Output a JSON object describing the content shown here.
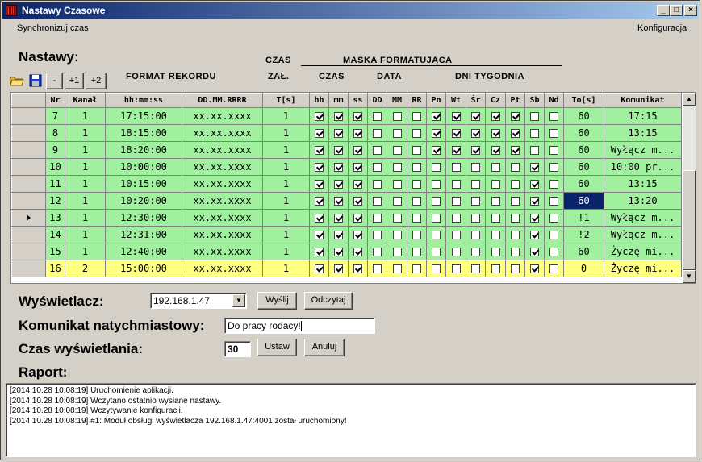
{
  "window": {
    "title": "Nastawy Czasowe"
  },
  "titlebar_buttons": {
    "minimize": "_",
    "maximize": "□",
    "close": "×"
  },
  "menu": {
    "left": "Synchronizuj czas",
    "right": "Konfiguracja"
  },
  "nastawy_label": "Nastawy:",
  "toolbar": {
    "minus": "-",
    "plus1": "+1",
    "plus2": "+2"
  },
  "headers": {
    "format_rekordu": "FORMAT REKORDU",
    "czas": "CZAS",
    "zal": "ZAŁ.",
    "maska": "MASKA FORMATUJĄCA",
    "czas2": "CZAS",
    "data": "DATA",
    "dni": "DNI TYGODNIA"
  },
  "columns": [
    "",
    "Nr",
    "Kanał",
    "hh:mm:ss",
    "DD.MM.RRRR",
    "T[s]",
    "hh",
    "mm",
    "ss",
    "DD",
    "MM",
    "RR",
    "Pn",
    "Wt",
    "Śr",
    "Cz",
    "Pt",
    "Sb",
    "Nd",
    "To[s]",
    "Komunikat"
  ],
  "rows": [
    {
      "nr": "7",
      "kanal": "1",
      "time": "17:15:00",
      "date": "xx.xx.xxxx",
      "t": "1",
      "checks": [
        1,
        1,
        1,
        0,
        0,
        0,
        1,
        1,
        1,
        1,
        1,
        0,
        0
      ],
      "to": "60",
      "msg": "17:15",
      "style": "green"
    },
    {
      "nr": "8",
      "kanal": "1",
      "time": "18:15:00",
      "date": "xx.xx.xxxx",
      "t": "1",
      "checks": [
        1,
        1,
        1,
        0,
        0,
        0,
        1,
        1,
        1,
        1,
        1,
        0,
        0
      ],
      "to": "60",
      "msg": "13:15",
      "style": "green"
    },
    {
      "nr": "9",
      "kanal": "1",
      "time": "18:20:00",
      "date": "xx.xx.xxxx",
      "t": "1",
      "checks": [
        1,
        1,
        1,
        0,
        0,
        0,
        1,
        1,
        1,
        1,
        1,
        0,
        0
      ],
      "to": "60",
      "msg": "Wyłącz m...",
      "style": "green"
    },
    {
      "nr": "10",
      "kanal": "1",
      "time": "10:00:00",
      "date": "xx.xx.xxxx",
      "t": "1",
      "checks": [
        1,
        1,
        1,
        0,
        0,
        0,
        0,
        0,
        0,
        0,
        0,
        1,
        0
      ],
      "to": "60",
      "msg": "10:00 pr...",
      "style": "green"
    },
    {
      "nr": "11",
      "kanal": "1",
      "time": "10:15:00",
      "date": "xx.xx.xxxx",
      "t": "1",
      "checks": [
        1,
        1,
        1,
        0,
        0,
        0,
        0,
        0,
        0,
        0,
        0,
        1,
        0
      ],
      "to": "60",
      "msg": "13:15",
      "style": "green"
    },
    {
      "nr": "12",
      "kanal": "1",
      "time": "10:20:00",
      "date": "xx.xx.xxxx",
      "t": "1",
      "checks": [
        1,
        1,
        1,
        0,
        0,
        0,
        0,
        0,
        0,
        0,
        0,
        1,
        0
      ],
      "to": "60",
      "msg": "13:20",
      "style": "green",
      "to_selected": true
    },
    {
      "nr": "13",
      "kanal": "1",
      "time": "12:30:00",
      "date": "xx.xx.xxxx",
      "t": "1",
      "checks": [
        1,
        1,
        1,
        0,
        0,
        0,
        0,
        0,
        0,
        0,
        0,
        1,
        0
      ],
      "to": "!1",
      "msg": "Wyłącz m...",
      "style": "green",
      "current": true
    },
    {
      "nr": "14",
      "kanal": "1",
      "time": "12:31:00",
      "date": "xx.xx.xxxx",
      "t": "1",
      "checks": [
        1,
        1,
        1,
        0,
        0,
        0,
        0,
        0,
        0,
        0,
        0,
        1,
        0
      ],
      "to": "!2",
      "msg": "Wyłącz m...",
      "style": "green"
    },
    {
      "nr": "15",
      "kanal": "1",
      "time": "12:40:00",
      "date": "xx.xx.xxxx",
      "t": "1",
      "checks": [
        1,
        1,
        1,
        0,
        0,
        0,
        0,
        0,
        0,
        0,
        0,
        1,
        0
      ],
      "to": "60",
      "msg": "Życzę mi...",
      "style": "green"
    },
    {
      "nr": "16",
      "kanal": "2",
      "time": "15:00:00",
      "date": "xx.xx.xxxx",
      "t": "1",
      "checks": [
        1,
        1,
        1,
        0,
        0,
        0,
        0,
        0,
        0,
        0,
        0,
        1,
        0
      ],
      "to": "0",
      "msg": "Życzę mi...",
      "style": "yellow"
    }
  ],
  "wyswietlacz": {
    "label": "Wyświetlacz:",
    "value": "192.168.1.47",
    "send": "Wyślij",
    "read": "Odczytaj"
  },
  "komunikat": {
    "label": "Komunikat natychmiastowy:",
    "value": "Do pracy rodacy!"
  },
  "czas_wysw": {
    "label": "Czas wyświetlania:",
    "value": "30",
    "set": "Ustaw",
    "cancel": "Anuluj"
  },
  "raport": {
    "label": "Raport:",
    "lines": [
      "[2014.10.28  10:08:19]  Uruchomienie aplikacji.",
      "[2014.10.28  10:08:19]  Wczytano ostatnio wysłane nastawy.",
      "[2014.10.28  10:08:19]  Wczytywanie konfiguracji.",
      "[2014.10.28  10:08:19]  #1: Moduł obsługi wyświetlacza 192.168.1.47:4001 został uruchomiony!"
    ]
  }
}
